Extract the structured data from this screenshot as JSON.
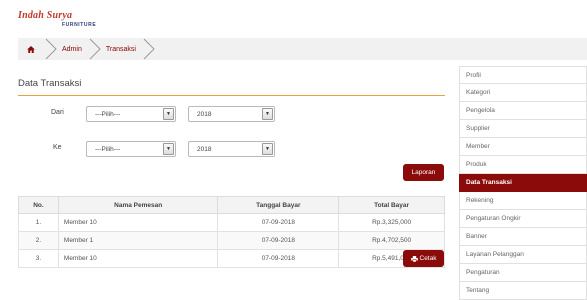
{
  "logo": {
    "top": "Indah Surya",
    "sub": "FURNITURE"
  },
  "breadcrumb": [
    {
      "label": "Admin"
    },
    {
      "label": "Transaksi"
    }
  ],
  "main": {
    "title": "Data Transaksi",
    "from": {
      "label": "Dari",
      "month": "---Pilih---",
      "year": "2018"
    },
    "to": {
      "label": "Ke",
      "month": "---Pilih---",
      "year": "2018"
    },
    "report_button": "Laporan",
    "print_button": "Cetak"
  },
  "table": {
    "headers": [
      "No.",
      "Nama Pemesan",
      "Tanggal Bayar",
      "Total Bayar"
    ],
    "rows": [
      [
        "1.",
        "Member 10",
        "07-09-2018",
        "Rp.3,325,000"
      ],
      [
        "2.",
        "Member 1",
        "07-09-2018",
        "Rp.4,702,500"
      ],
      [
        "3.",
        "Member 10",
        "07-09-2018",
        "Rp.5,491,000"
      ]
    ]
  },
  "sidebar": {
    "items": [
      {
        "label": "Profil"
      },
      {
        "label": "Kategori"
      },
      {
        "label": "Pengelola"
      },
      {
        "label": "Supplier"
      },
      {
        "label": "Member"
      },
      {
        "label": "Produk"
      },
      {
        "label": "Data Transaksi",
        "active": true
      },
      {
        "label": "Rekening"
      },
      {
        "label": "Pengaturan Ongkir"
      },
      {
        "label": "Banner"
      },
      {
        "label": "Layanan Pelanggan"
      },
      {
        "label": "Pengaturan"
      },
      {
        "label": "Tentang"
      }
    ]
  },
  "colors": {
    "accent": "#8b0a0a",
    "rule": "#e8a040",
    "breadcrumb_bg": "#f1f1f1"
  },
  "icons": {
    "home": "home-icon",
    "print": "print-icon",
    "caret": "caret-down-icon"
  }
}
